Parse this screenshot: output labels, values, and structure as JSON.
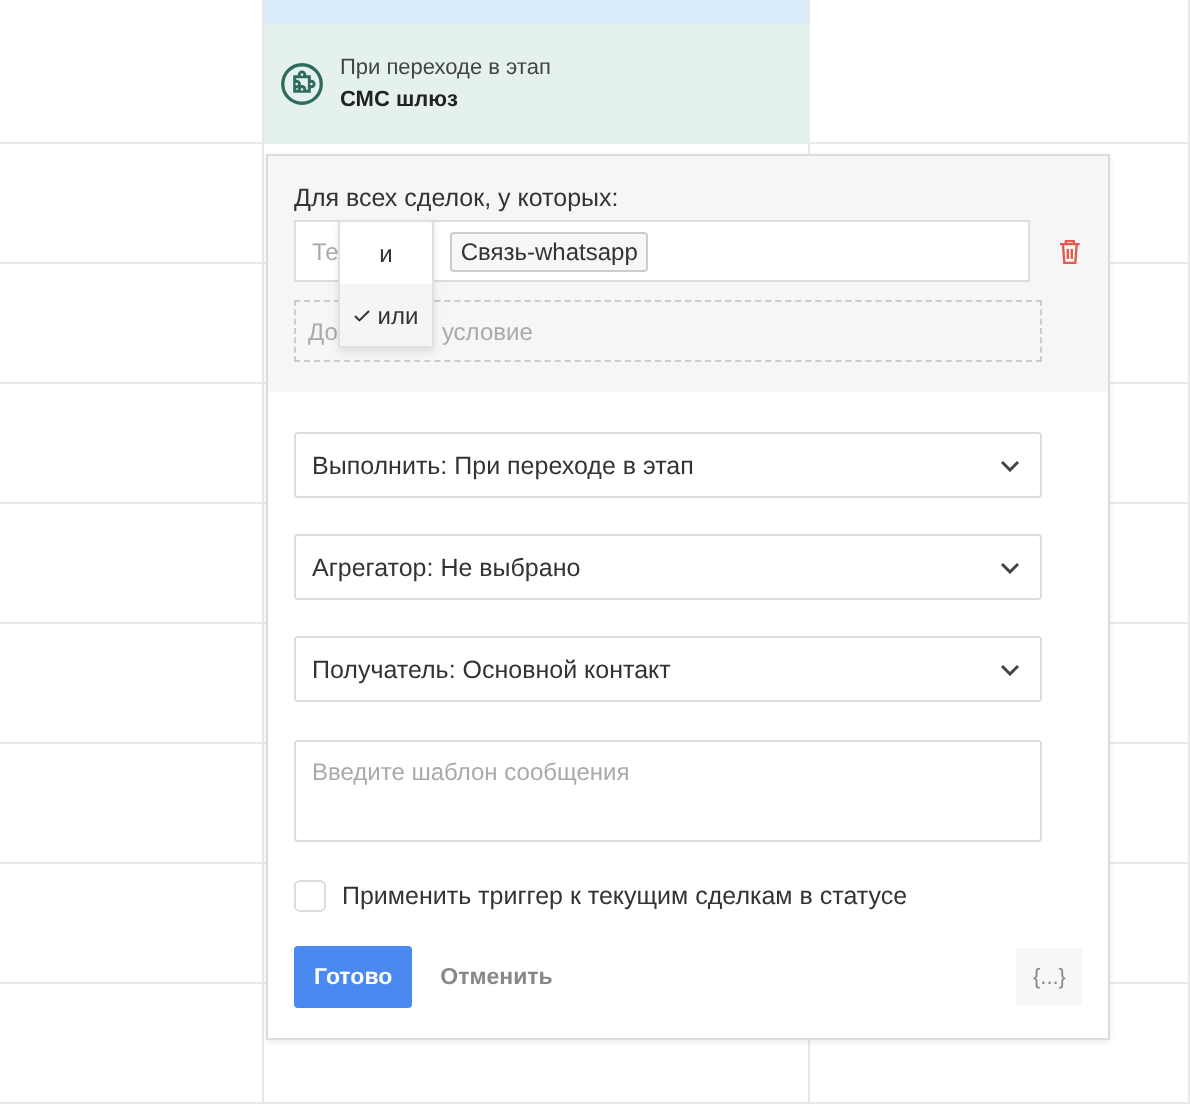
{
  "trigger_card": {
    "subtitle": "При переходе в этап",
    "title": "СМС шлюз"
  },
  "conditions": {
    "heading": "Для всех сделок, у которых:",
    "field_placeholder": "Те",
    "tags": [
      "Связь-whatsapp"
    ],
    "add_condition_parts": [
      "До",
      "условие"
    ]
  },
  "logic_menu": [
    {
      "label": "и",
      "selected": false
    },
    {
      "label": "или",
      "selected": true
    }
  ],
  "selects": [
    "Выполнить: При переходе в этап",
    "Агрегатор: Не выбрано",
    "Получатель: Основной контакт"
  ],
  "message": {
    "placeholder": "Введите шаблон сообщения"
  },
  "apply_checkbox": {
    "label": "Применить триггер к текущим сделкам в статусе",
    "checked": false
  },
  "buttons": {
    "done": "Готово",
    "cancel": "Отменить",
    "variables": "{...}"
  }
}
